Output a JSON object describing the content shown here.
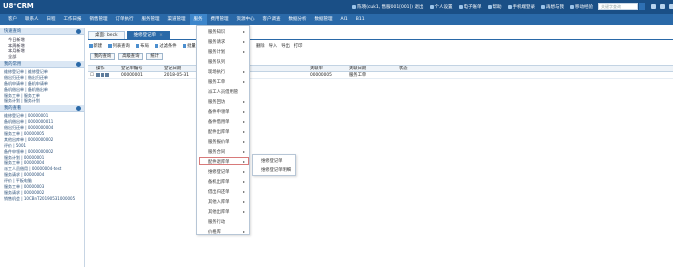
{
  "app": {
    "logo": "U8⁺CRM"
  },
  "topbar": {
    "user": "陈晓(cuk1, 售服001[001]) 退出",
    "personal": "个人设置",
    "ebill": "电子账单",
    "help": "帮助",
    "mobile": "手机端登录",
    "service": "再想与我",
    "mobile2": "移动经验",
    "search_placeholder": "关键字查询"
  },
  "menu": [
    "客户",
    "联系人",
    "日程",
    "工作日报",
    "销售管理",
    "订单执行",
    "服务管理",
    "渠道管理",
    "服务",
    "费用管理",
    "资源中心",
    "客户调查",
    "数据分析",
    "数据管理",
    "AI1",
    "B11"
  ],
  "menu_active": "服务",
  "sidebar": {
    "quick_title": "快速查询",
    "quick_items": [
      "今日新增",
      "本周新增",
      "本月新增",
      "全部"
    ],
    "hot_title": "我的常用",
    "hot_items": [
      "维修登记单 | 维修登记单",
      "借出归还单 | 借出归还单",
      "备机申请单 | 备机申请单",
      "备机借出单 | 备机借出单",
      "服务工单 | 服务工单",
      "服务计划 | 服务计划"
    ],
    "recent_title": "我的查看",
    "recent_items": [
      "维修登记单 | 00000001",
      "备机借出单 | 0000000011",
      "借出归还单 | 0000000004",
      "服务工单 | 00000005",
      "其他出库单 | 0000000002",
      "评价 | 5001",
      "备件申领单 | 0000000002",
      "服务计划 | 00000001",
      "服务工单 | 00000004",
      "派工人员借用 | 00000004-test",
      "服务请求 | 00000004",
      "评价 | 平板电脑",
      "服务工单 | 00000003",
      "服务请求 | 00000002",
      "销售机会 | 10CBnT20190531000005"
    ]
  },
  "tabs": [
    {
      "label": "桌面: beck"
    },
    {
      "label": "维修登记单"
    }
  ],
  "toolbar": [
    "新建",
    "列表查询",
    "布局",
    "过滤条件",
    "批量"
  ],
  "toolbar_right": [
    "删除",
    "导入",
    "导出",
    "打印"
  ],
  "filter": {
    "scheme": "我的查询",
    "advanced": "高级查询",
    "stats": "统计"
  },
  "grid": {
    "headers": [
      "",
      "操作",
      "登记单编号",
      "登记日期",
      "",
      "",
      "关联单",
      "关联日期",
      "状态"
    ],
    "rows": [
      {
        "no": "00000001",
        "date": "2018-05-31",
        "doc": "00000005",
        "doc_type": "服务工单",
        "status": ""
      }
    ]
  },
  "dropdown": {
    "items": [
      "服务知识",
      "服务请求",
      "服务计划",
      "服务队列",
      "现场执行",
      "服务工单",
      "派工人员借用管",
      "服务回访",
      "备件申领单",
      "备件借用单",
      "配件出库单",
      "服务报价单",
      "服务合同",
      "配件退库单",
      "维修登记单",
      "备机出库单",
      "借出归还单",
      "其他入库单",
      "其他出库单",
      "服务行动",
      "价格库"
    ],
    "has_arrow": [
      true,
      true,
      true,
      false,
      true,
      true,
      false,
      true,
      true,
      true,
      true,
      true,
      true,
      true,
      true,
      true,
      true,
      true,
      true,
      false,
      true
    ],
    "selected": "维修登记单",
    "submenu": [
      "维修登记单",
      "维修登记单明细"
    ]
  }
}
